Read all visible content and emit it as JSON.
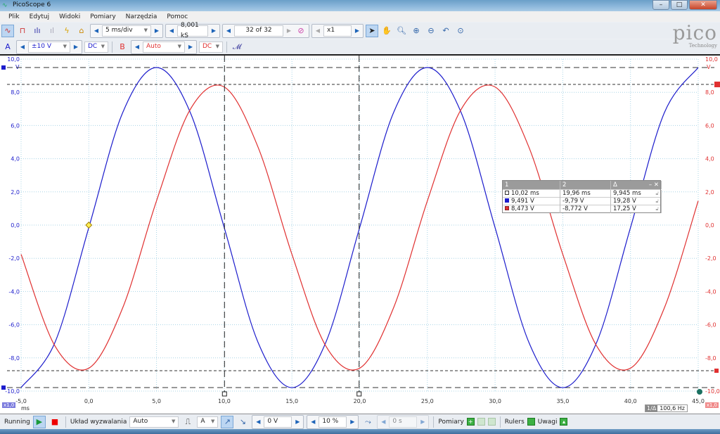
{
  "window": {
    "title": "PicoScope 6",
    "min": "–",
    "max": "□",
    "close": "✕"
  },
  "menu": [
    "Plik",
    "Edytuj",
    "Widoki",
    "Pomiary",
    "Narzędzia",
    "Pomoc"
  ],
  "toolbar": {
    "timebase": "5 ms/div",
    "samples": "8,001 kS",
    "buffer": "32 of 32",
    "zoom": "x1"
  },
  "channel_a": {
    "label": "A",
    "range": "±10 V",
    "coupling": "DC",
    "color": "#1c1ccc"
  },
  "channel_b": {
    "label": "B",
    "range": "Auto",
    "coupling": "DC",
    "color": "#e03030"
  },
  "logo": {
    "text": "pico",
    "sub": "Technology"
  },
  "cursor_table": {
    "headers": [
      "1",
      "2",
      "Δ"
    ],
    "rows": [
      [
        "10,02 ms",
        "19,96 ms",
        "9,945 ms"
      ],
      [
        "9,491 V",
        "-9,79 V",
        "19,28 V"
      ],
      [
        "8,473 V",
        "-8,772 V",
        "17,25 V"
      ]
    ]
  },
  "axis": {
    "x_unit": "ms",
    "left_unit": "V",
    "right_unit": "V",
    "left_scale": "x1,0",
    "right_scale": "x1,0",
    "frequency": "100,6 Hz",
    "freq_label": "1/Δ"
  },
  "bottom": {
    "status": "Running",
    "trigger_label": "Układ wyzwalania",
    "trigger_mode": "Auto",
    "trigger_source": "A",
    "threshold": "0 V",
    "pretrigger": "10 %",
    "delay": "0 s",
    "measurements": "Pomiary",
    "rulers": "Rulers",
    "notes": "Uwagi"
  },
  "chart_data": {
    "type": "line",
    "xlim": [
      -5,
      45
    ],
    "ylim": [
      -10,
      10
    ],
    "x_ticks": [
      "-5,0",
      "0,0",
      "5,0",
      "10,0",
      "15,0",
      "20,0",
      "25,0",
      "30,0",
      "35,0",
      "40,0",
      "45,0"
    ],
    "y_ticks": [
      "10,0",
      "8,0",
      "6,0",
      "4,0",
      "2,0",
      "0,0",
      "-2,0",
      "-4,0",
      "-6,0",
      "-8,0",
      "-10,0"
    ],
    "x": [
      -5,
      -2.5,
      0,
      2.5,
      5,
      7.5,
      10,
      12.5,
      15,
      17.5,
      20,
      22.5,
      25,
      27.5,
      30,
      32.5,
      35,
      37.5,
      40,
      42.5,
      45
    ],
    "series": [
      {
        "channel": "A",
        "color": "#1c1ccc",
        "values": [
          -9.79,
          -7.07,
          -0.15,
          6.77,
          9.49,
          6.77,
          -0.15,
          -7.07,
          -9.79,
          -7.07,
          -0.15,
          6.77,
          9.49,
          6.77,
          -0.15,
          -7.07,
          -9.79,
          -7.07,
          -0.15,
          6.77,
          9.49
        ]
      },
      {
        "channel": "B",
        "color": "#e03030",
        "values": [
          -1.76,
          -7.28,
          -8.62,
          -4.99,
          1.46,
          6.98,
          8.32,
          4.69,
          -1.76,
          -7.28,
          -8.62,
          -4.99,
          1.46,
          6.98,
          8.32,
          4.69,
          -1.76,
          -7.28,
          -8.62,
          -4.99,
          1.46
        ]
      }
    ],
    "time_cursors": [
      10.02,
      19.96
    ],
    "signal_cursors": [
      9.491,
      -9.79,
      8.473,
      -8.772
    ],
    "trigger_point": [
      0,
      0
    ],
    "grid": true
  }
}
